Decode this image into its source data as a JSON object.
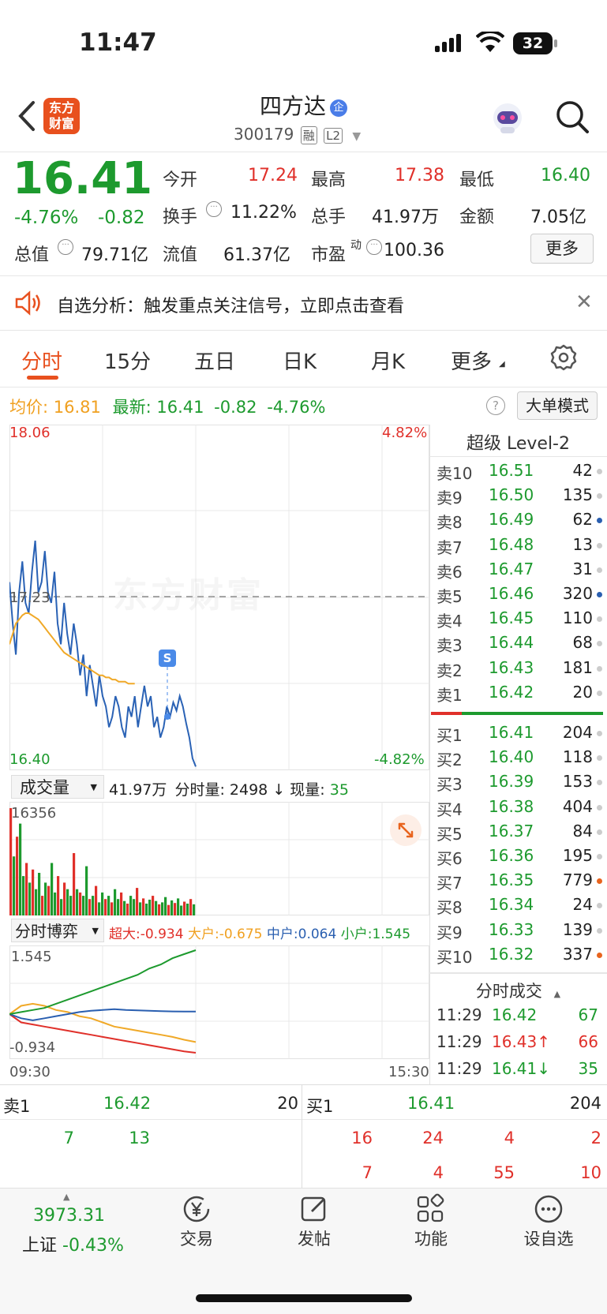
{
  "status": {
    "time": "11:47",
    "battery": "32"
  },
  "header": {
    "logo_text": "东方财富",
    "stock_name": "四方达",
    "enterprise_badge": "企",
    "stock_code": "300179",
    "tag_margin": "融",
    "tag_level": "L2"
  },
  "quote": {
    "price": "16.41",
    "change_pct": "-4.76%",
    "change": "-0.82",
    "open_label": "今开",
    "open": "17.24",
    "high_label": "最高",
    "high": "17.38",
    "low_label": "最低",
    "low": "16.40",
    "turnover_label": "换手",
    "turnover": "11.22%",
    "volume_label": "总手",
    "volume": "41.97万",
    "amount_label": "金额",
    "amount": "7.05亿",
    "mktcap_label": "总值",
    "mktcap": "79.71亿",
    "float_label": "流值",
    "float_cap": "61.37亿",
    "pe_label": "市盈",
    "pe_sup": "动",
    "pe": "100.36",
    "more_button": "更多"
  },
  "banner": {
    "text": "自选分析：触发重点关注信号，立即点击查看"
  },
  "tabs": [
    "分时",
    "15分",
    "五日",
    "日K",
    "月K",
    "更多"
  ],
  "chart_info": {
    "avg_label": "均价:",
    "avg": "16.81",
    "latest_label": "最新:",
    "latest": "16.41",
    "latest_chg": "-0.82",
    "latest_pct": "-4.76%",
    "big_order_mode": "大单模式",
    "help": "?"
  },
  "chart_data": [
    {
      "type": "line",
      "price_top": "18.06",
      "price_bottom": "16.40",
      "pct_top": "4.82%",
      "pct_bottom": "-4.82%",
      "ref_price": "17.23",
      "watermark": "东方财富",
      "marker": "S",
      "ylim": [
        16.4,
        18.06
      ],
      "series": [
        {
          "values": [
            17.3,
            17.1,
            16.95,
            17.25,
            17.4,
            17.2,
            17.15,
            17.35,
            17.5,
            17.25,
            17.3,
            17.45,
            17.25,
            17.2,
            17.35,
            17.1,
            17.0,
            17.2,
            17.05,
            16.95,
            17.1,
            17.0,
            16.85,
            16.95,
            16.75,
            16.9,
            16.8,
            16.7,
            16.85,
            16.75,
            16.7,
            16.6,
            16.65,
            16.75,
            16.7,
            16.6,
            16.55,
            16.7,
            16.65,
            16.75,
            16.6,
            16.7,
            16.8,
            16.7,
            16.75,
            16.6,
            16.65,
            16.55,
            16.6,
            16.7,
            16.65,
            16.72,
            16.68,
            16.75,
            16.7,
            16.62,
            16.55,
            16.45,
            16.41
          ]
        },
        {
          "values": [
            17.0,
            17.05,
            17.1,
            17.12,
            17.14,
            17.15,
            17.15,
            17.14,
            17.13,
            17.12,
            17.1,
            17.08,
            17.06,
            17.04,
            17.02,
            17.0,
            16.98,
            16.96,
            16.95,
            16.94,
            16.93,
            16.92,
            16.91,
            16.9,
            16.89,
            16.88,
            16.87,
            16.86,
            16.85,
            16.85,
            16.84,
            16.84,
            16.83,
            16.83,
            16.82,
            16.82,
            16.82,
            16.81,
            16.81,
            16.81
          ]
        }
      ]
    },
    {
      "type": "bar",
      "ylabel": "16356",
      "values": [
        16356,
        9000,
        12000,
        14000,
        6000,
        8000,
        5000,
        7000,
        4000,
        6500,
        3000,
        5000,
        4500,
        8000,
        3500,
        6000,
        2500,
        5000,
        4000,
        3000,
        9500,
        4000,
        3500,
        3000,
        7500,
        2500,
        3000,
        4500,
        2000,
        3500,
        2500,
        3000,
        2000,
        4000,
        2500,
        3500,
        2200,
        1800,
        3000,
        2500,
        4200,
        2000,
        2600,
        1800,
        2400,
        3000,
        2200,
        1700,
        2000,
        2800,
        1600,
        2300,
        1900,
        2600,
        1500,
        2100,
        1800,
        2498,
        1700
      ]
    },
    {
      "type": "line",
      "top_label": "1.545",
      "bottom_label": "-0.934",
      "x_start": "09:30",
      "x_end": "15:30",
      "series": [
        {
          "name": "超大",
          "values": [
            0,
            -0.2,
            -0.25,
            -0.3,
            -0.35,
            -0.4,
            -0.45,
            -0.5,
            -0.55,
            -0.6,
            -0.65,
            -0.7,
            -0.75,
            -0.8,
            -0.85,
            -0.9,
            -0.934
          ]
        },
        {
          "name": "大户",
          "values": [
            0,
            0.2,
            0.25,
            0.2,
            0.1,
            0.05,
            -0.05,
            -0.1,
            -0.2,
            -0.3,
            -0.35,
            -0.4,
            -0.45,
            -0.5,
            -0.55,
            -0.62,
            -0.675
          ]
        },
        {
          "name": "中户",
          "values": [
            0,
            -0.1,
            -0.15,
            -0.1,
            -0.05,
            0.0,
            0.05,
            0.08,
            0.1,
            0.12,
            0.1,
            0.09,
            0.08,
            0.07,
            0.065,
            0.064,
            0.064
          ]
        },
        {
          "name": "小户",
          "values": [
            0,
            0.05,
            0.1,
            0.15,
            0.25,
            0.35,
            0.45,
            0.55,
            0.65,
            0.75,
            0.85,
            0.95,
            1.1,
            1.2,
            1.35,
            1.45,
            1.545
          ]
        }
      ]
    }
  ],
  "volume_panel": {
    "dropdown": "成交量",
    "total": "41.97万",
    "min_vol_label": "分时量:",
    "min_vol": "2498",
    "cur_label": "现量:",
    "cur": "35"
  },
  "game_panel": {
    "dropdown": "分时博弈",
    "super_label": "超大:",
    "super": "-0.934",
    "big_label": "大户:",
    "big": "-0.675",
    "mid_label": "中户:",
    "mid": "0.064",
    "small_label": "小户:",
    "small": "1.545"
  },
  "level2": {
    "title": "超级 Level-2",
    "sells": [
      {
        "label": "卖10",
        "price": "16.51",
        "vol": "42",
        "dot": "#cccccc"
      },
      {
        "label": "卖9",
        "price": "16.50",
        "vol": "135",
        "dot": "#cccccc"
      },
      {
        "label": "卖8",
        "price": "16.49",
        "vol": "62",
        "dot": "#2a5fb0"
      },
      {
        "label": "卖7",
        "price": "16.48",
        "vol": "13",
        "dot": "#cccccc"
      },
      {
        "label": "卖6",
        "price": "16.47",
        "vol": "31",
        "dot": "#cccccc"
      },
      {
        "label": "卖5",
        "price": "16.46",
        "vol": "320",
        "dot": "#2a5fb0"
      },
      {
        "label": "卖4",
        "price": "16.45",
        "vol": "110",
        "dot": "#cccccc"
      },
      {
        "label": "卖3",
        "price": "16.44",
        "vol": "68",
        "dot": "#cccccc"
      },
      {
        "label": "卖2",
        "price": "16.43",
        "vol": "181",
        "dot": "#cccccc"
      },
      {
        "label": "卖1",
        "price": "16.42",
        "vol": "20",
        "dot": "#cccccc"
      }
    ],
    "buys": [
      {
        "label": "买1",
        "price": "16.41",
        "vol": "204",
        "dot": "#cccccc"
      },
      {
        "label": "买2",
        "price": "16.40",
        "vol": "118",
        "dot": "#cccccc"
      },
      {
        "label": "买3",
        "price": "16.39",
        "vol": "153",
        "dot": "#cccccc"
      },
      {
        "label": "买4",
        "price": "16.38",
        "vol": "404",
        "dot": "#cccccc"
      },
      {
        "label": "买5",
        "price": "16.37",
        "vol": "84",
        "dot": "#cccccc"
      },
      {
        "label": "买6",
        "price": "16.36",
        "vol": "195",
        "dot": "#cccccc"
      },
      {
        "label": "买7",
        "price": "16.35",
        "vol": "779",
        "dot": "#e8641e"
      },
      {
        "label": "买8",
        "price": "16.34",
        "vol": "24",
        "dot": "#cccccc"
      },
      {
        "label": "买9",
        "price": "16.33",
        "vol": "139",
        "dot": "#cccccc"
      },
      {
        "label": "买10",
        "price": "16.32",
        "vol": "337",
        "dot": "#e8641e"
      }
    ]
  },
  "trades": {
    "title": "分时成交",
    "rows": [
      {
        "time": "11:29",
        "price": "16.42",
        "vol": "67"
      },
      {
        "time": "11:29",
        "price": "16.43↑",
        "vol": "66"
      },
      {
        "time": "11:29",
        "price": "16.41↓",
        "vol": "35"
      }
    ]
  },
  "queue": {
    "sell1_label": "卖1",
    "sell1_price": "16.42",
    "sell1_vol": "20",
    "buy1_label": "买1",
    "buy1_price": "16.41",
    "buy1_vol": "204",
    "sell_orders": [
      "7",
      "13"
    ],
    "buy_orders": [
      "16",
      "24",
      "4",
      "2",
      "7",
      "4",
      "55",
      "10"
    ]
  },
  "bottom_nav": {
    "index_value": "3973.31",
    "index_name": "上证",
    "index_pct": "-0.43%",
    "items": [
      {
        "label": "交易",
        "icon": "yen-icon"
      },
      {
        "label": "发帖",
        "icon": "edit-icon"
      },
      {
        "label": "功能",
        "icon": "grid-icon"
      },
      {
        "label": "设自选",
        "icon": "more-icon"
      }
    ]
  }
}
